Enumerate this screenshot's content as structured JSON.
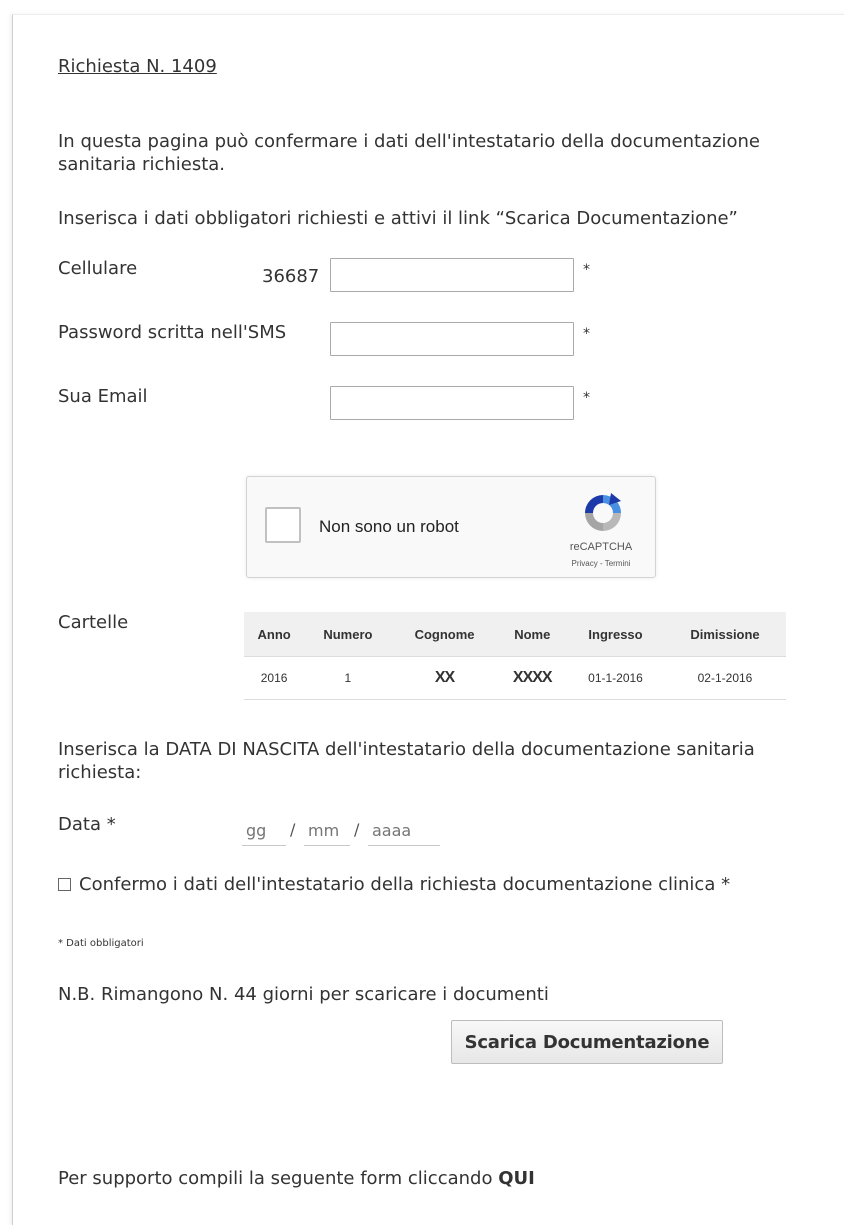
{
  "request": {
    "title": "Richiesta N. 1409"
  },
  "intro": {
    "text": "In questa pagina può confermare i dati dell'intestatario della documentazione sanitaria richiesta.",
    "instruction": "Inserisca i dati obbligatori richiesti e attivi il link “Scarica Documentazione”"
  },
  "form": {
    "cellulare": {
      "label": "Cellulare",
      "prefix": "36687",
      "value": "",
      "required_mark": "*"
    },
    "password": {
      "label": "Password scritta nell'SMS",
      "value": "",
      "required_mark": "*"
    },
    "email": {
      "label": "Sua Email",
      "value": "",
      "required_mark": "*"
    }
  },
  "captcha": {
    "label": "Non sono un robot",
    "brand": "reCAPTCHA",
    "links": "Privacy - Termini",
    "checked": false
  },
  "cartelle": {
    "label": "Cartelle",
    "columns": [
      "Anno",
      "Numero",
      "Cognome",
      "Nome",
      "Ingresso",
      "Dimissione"
    ],
    "rows": [
      {
        "anno": "2016",
        "numero": "1",
        "cognome": "XX",
        "nome": "XXXX",
        "ingresso": "01-1-2016",
        "dimissione": "02-1-2016"
      }
    ]
  },
  "birth": {
    "instruction": "Inserisca la DATA DI NASCITA dell'intestatario della documentazione sanitaria richiesta:",
    "label": "Data *",
    "day_placeholder": "gg",
    "month_placeholder": "mm",
    "year_placeholder": "aaaa",
    "separator": "/"
  },
  "confirm": {
    "label": "Confermo i dati dell'intestatario della richiesta documentazione clinica *",
    "checked": false
  },
  "notes": {
    "mandatory": "* Dati obbligatori",
    "remaining": "N.B. Rimangono N. 44 giorni per scaricare i documenti"
  },
  "actions": {
    "download_label": "Scarica Documentazione"
  },
  "support": {
    "text": "Per supporto compili la seguente form cliccando ",
    "link_label": "QUI"
  },
  "colors": {
    "captcha_blue": "#1c3aa9",
    "captcha_grey": "#b8b8b8",
    "table_header": "#f0f0f0"
  }
}
